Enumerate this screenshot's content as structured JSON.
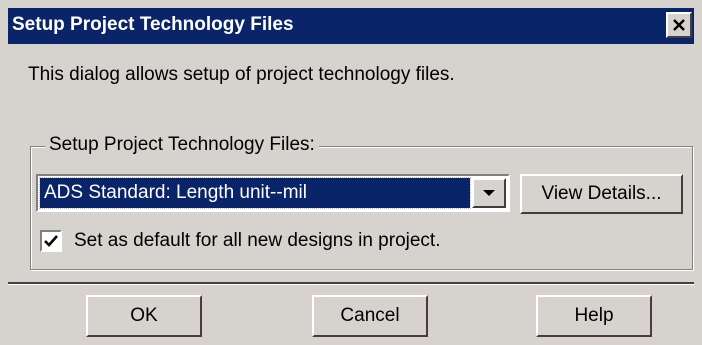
{
  "dialog": {
    "title": "Setup Project Technology Files",
    "close_icon": "close-icon",
    "description": "This dialog allows setup of project technology files."
  },
  "group": {
    "legend": "Setup Project Technology Files:",
    "combo_value": "ADS Standard: Length unit--mil",
    "details_label": "View Details...",
    "checkbox_checked": true,
    "checkbox_label": "Set as default for all new designs in project."
  },
  "buttons": {
    "ok": "OK",
    "cancel": "Cancel",
    "help": "Help"
  },
  "colors": {
    "title_bar": "#0a246a",
    "face": "#d6d3ce",
    "selection": "#0a246a"
  }
}
